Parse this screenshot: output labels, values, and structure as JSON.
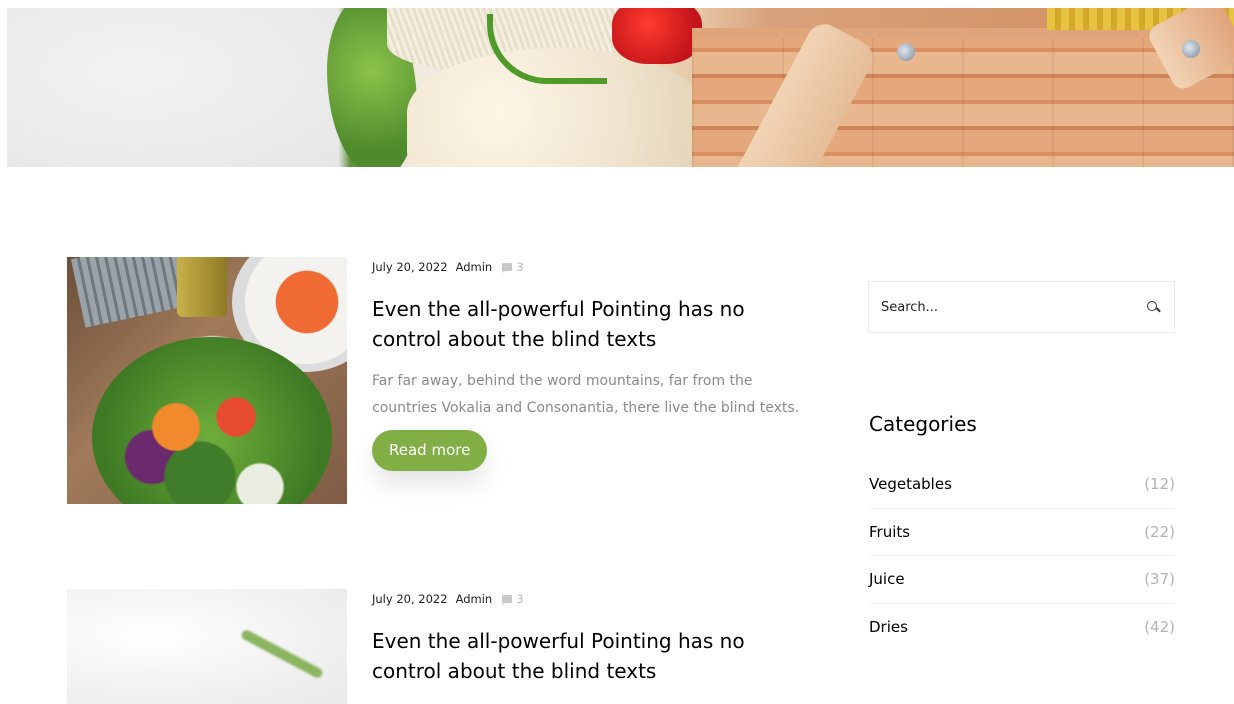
{
  "hero": {
    "image": "vegetables-basket-banner"
  },
  "posts": [
    {
      "date": "July 20, 2022",
      "author": "Admin",
      "comments": "3",
      "title": "Even the all-powerful Pointing has no control about the blind texts",
      "excerpt": "Far far away, behind the word mountains, far from the countries Vokalia and Consonantia, there live the blind texts.",
      "read_more": "Read more",
      "image": "salad-bowl-photo"
    },
    {
      "date": "July 20, 2022",
      "author": "Admin",
      "comments": "3",
      "title": "Even the all-powerful Pointing has no control about the blind texts",
      "image": "white-cloth-herbs-photo"
    }
  ],
  "sidebar": {
    "search": {
      "placeholder": "Search..."
    },
    "categories_heading": "Categories",
    "categories": [
      {
        "label": "Vegetables",
        "count": "(12)"
      },
      {
        "label": "Fruits",
        "count": "(22)"
      },
      {
        "label": "Juice",
        "count": "(37)"
      },
      {
        "label": "Dries",
        "count": "(42)"
      }
    ]
  },
  "colors": {
    "accent": "#82ae46",
    "muted_text": "#8a8a8a",
    "count_text": "#b3b3b3"
  }
}
